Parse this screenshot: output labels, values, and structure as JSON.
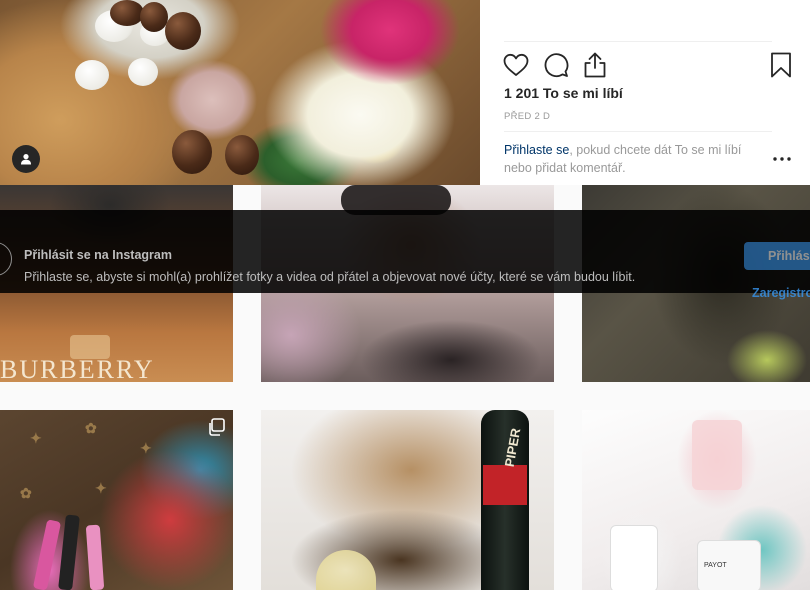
{
  "post": {
    "likes": "1 201 To se mi líbí",
    "time": "PŘED 2 D",
    "login_prompt": {
      "link": "Přihlaste se",
      "rest": ", pokud chcete dát To se mi líbí nebo přidat komentář."
    }
  },
  "icons": {
    "like": "heart-icon",
    "comment": "comment-icon",
    "share": "share-icon",
    "save": "bookmark-icon",
    "more": "more-options-icon",
    "avatar": "user-icon",
    "multi": "multiple-photos-icon"
  },
  "grid": {
    "tile1_text": "BURBERRY",
    "tile5_text": "PIPER",
    "tile6_text": "PAYOT"
  },
  "banner": {
    "title": "Přihlásit se na Instagram",
    "text": "Přihlaste se, abyste si mohl(a) prohlížet fotky a videa od přátel a objevovat nové účty, které se vám budou líbit.",
    "login_button": "Přihlásit se",
    "register_link": "Zaregistrovat se"
  },
  "colors": {
    "accent": "#3897f0",
    "link": "#003569",
    "muted": "#999999",
    "text": "#262626"
  }
}
